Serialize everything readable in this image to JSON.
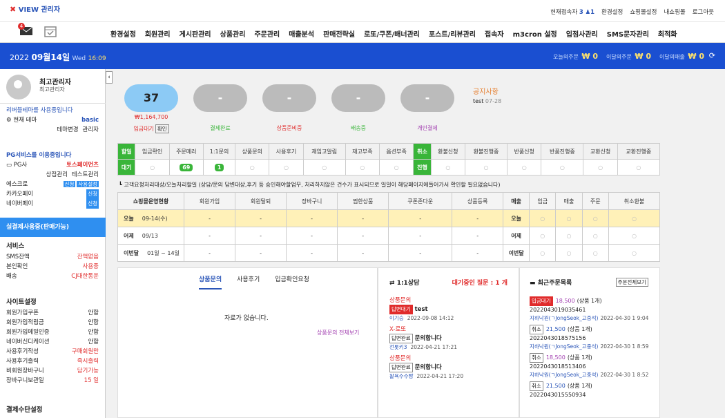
{
  "brand": {
    "logo": "VIEW 관리자"
  },
  "toplinks": {
    "online_label": "현재접속자",
    "online_count": "3",
    "online_users": "1",
    "links": [
      "환경설정",
      "쇼핑몰설정",
      "내쇼핑몰",
      "로그아웃"
    ]
  },
  "icons": {
    "mail_badge": "4"
  },
  "menu": [
    "환경설정",
    "회원관리",
    "게시판관리",
    "상품관리",
    "주문관리",
    "매출분석",
    "판매전략실",
    "로또/쿠폰/배너관리",
    "포스트/리뷰관리",
    "접속자",
    "m3cron 설정",
    "입점사관리",
    "SMS문자관리",
    "최적화"
  ],
  "datebar": {
    "year": "2022",
    "day": "09월14일",
    "weekday": "Wed",
    "time": "16:09",
    "today_order_label": "오늘의주문",
    "today_order": "₩ 0",
    "month_order_label": "이달의주문",
    "month_order": "₩ 0",
    "month_sales_label": "이달의매출",
    "month_sales": "₩ 0"
  },
  "admin": {
    "name": "최고관리자",
    "role": "최고관리자"
  },
  "theme": {
    "notice": "리버블테마를 사용중입니다",
    "label": "현재 테마",
    "value": "basic",
    "change": "테마변경",
    "manage": "관리자"
  },
  "pg": {
    "notice": "PG서비스를 이용중입니다",
    "label": "PG사",
    "value": "토스페이먼츠",
    "mall": "상점관리",
    "test": "테스트관리",
    "escrow": "에스크로",
    "escrow_tag1": "신청",
    "escrow_tag2": "사용설정",
    "kakao": "카카오페이",
    "kakao_tag": "신청",
    "naver": "네이버페이",
    "naver_tag": "신청"
  },
  "payband": "실결제사용중(판매가능)",
  "services": {
    "title": "서비스",
    "items": [
      {
        "k": "SMS잔액",
        "v": "잔액없음"
      },
      {
        "k": "본인확인",
        "v": "사용중"
      },
      {
        "k": "배송",
        "v": "CJ대한통운"
      }
    ]
  },
  "site": {
    "title": "사이트설정",
    "items": [
      {
        "k": "회원가입쿠폰",
        "v": "안함"
      },
      {
        "k": "회원가입적립금",
        "v": "안함"
      },
      {
        "k": "회원가입메일인증",
        "v": "안함"
      },
      {
        "k": "네이버신디케이션",
        "v": "안함"
      },
      {
        "k": "사용후기작성",
        "v": "구매회원만"
      },
      {
        "k": "사용후기출력",
        "v": "즉시출력"
      },
      {
        "k": "비회원장바구니",
        "v": "담기가능"
      },
      {
        "k": "장바구니보관일",
        "v": "15 일"
      }
    ]
  },
  "payment_title": "결제수단설정",
  "summary": [
    {
      "value": "37",
      "amount": "₩1,164,700",
      "label": "입금대기",
      "btn": "확인"
    },
    {
      "value": "-",
      "label": "결제완료"
    },
    {
      "value": "-",
      "label": "상품준비중"
    },
    {
      "value": "-",
      "label": "배송중"
    },
    {
      "value": "-",
      "label": "개인결제"
    }
  ],
  "notice": {
    "title": "공지사항",
    "item": "test",
    "date": "07-28"
  },
  "status": {
    "h1": "할일",
    "h2": "대기",
    "cols": [
      "입금확인",
      "주문메러",
      "1:1문의",
      "상품문의",
      "사용후기",
      "재입고알림",
      "재고부족",
      "옵션부족"
    ],
    "vals": [
      "○",
      "69",
      "1",
      "○",
      "○",
      "○",
      "○",
      "○"
    ],
    "h3": "취소",
    "h4": "진행",
    "cols2": [
      "환불신청",
      "환불진행중",
      "반품신청",
      "반품진행중",
      "교환신청",
      "교환진행중"
    ],
    "vals2": [
      "○",
      "○",
      "○",
      "○",
      "○",
      "○"
    ]
  },
  "note": "고객요청처리대상/오늘처리할일 (상담/문의 답변대상,후기 등 승인해야할업무, 처리하지않은 건수가 표시되므로 일일이 해당페이지에들어가서 확인할 필요없습니다)",
  "stats": {
    "hdr": "쇼핑몰운영현황",
    "cols": [
      "회원가입",
      "회원탈퇴",
      "장바구니",
      "찜한상품",
      "쿠폰존다운",
      "상품등록"
    ],
    "sales": "매출",
    "cols2": [
      "입금",
      "매출",
      "주문",
      "취소환불"
    ],
    "rows": [
      {
        "label": "오늘",
        "date": "09-14(수)",
        "vals": [
          "-",
          "-",
          "-",
          "-",
          "-",
          "-"
        ],
        "v2": [
          "○",
          "○",
          "○",
          "○"
        ]
      },
      {
        "label": "어제",
        "date": "09/13",
        "vals": [
          "-",
          "-",
          "-",
          "-",
          "-",
          "-"
        ],
        "v2": [
          "○",
          "○",
          "○",
          "○"
        ]
      },
      {
        "label": "이번달",
        "date": "01일 ~ 14일",
        "vals": [
          "-",
          "-",
          "-",
          "-",
          "-",
          "-"
        ],
        "v2": [
          "○",
          "○",
          "○",
          "○"
        ]
      }
    ]
  },
  "qa": {
    "tabs": [
      "상품문의",
      "사용후기",
      "입금확인요청"
    ],
    "empty": "자료가 없습니다.",
    "all": "상품문의 전체보기"
  },
  "consult": {
    "title": "1:1상담",
    "waiting": "대기중인 질문 : 1 개",
    "items": [
      {
        "cat": "상품문의",
        "tag": "답변대기",
        "title": "test",
        "user": "이기승",
        "date": "2022-09-08 14:12"
      },
      {
        "cat": "X-로또",
        "tag": "답변완료",
        "title": "문의합니다",
        "user": "전롯키3",
        "date": "2022-04-21 17:21"
      },
      {
        "cat": "상품문의",
        "tag": "답변완료",
        "title": "문의합니다",
        "user": "왈욕수수빵",
        "date": "2022-04-21 17:20"
      }
    ]
  },
  "orders": {
    "title": "최근주문목록",
    "all": "주문전체보기",
    "items": [
      {
        "st": "입금대기",
        "amt": "18,500",
        "cnt": "(상품 1개)",
        "no": "2022043019035461",
        "user": "지하낙원(ㄱJongSeok_고중석)",
        "date": "2022-04-30 1 9:04"
      },
      {
        "st": "취소",
        "amt": "21,500",
        "cnt": "(상품 1개)",
        "no": "2022043018575156",
        "user": "지하낙원(ㄱJongSeok_고중석)",
        "date": "2022-04-30 1 8:59"
      },
      {
        "st": "취소",
        "amt": "18,500",
        "cnt": "(상품 1개)",
        "no": "2022043018513406",
        "user": "지하낙원(ㄱJongSeok_고중석)",
        "date": "2022-04-30 1 8:52"
      },
      {
        "st": "취소",
        "amt": "21,500",
        "cnt": "(상품 1개)",
        "no": "2022043015550934"
      }
    ]
  }
}
